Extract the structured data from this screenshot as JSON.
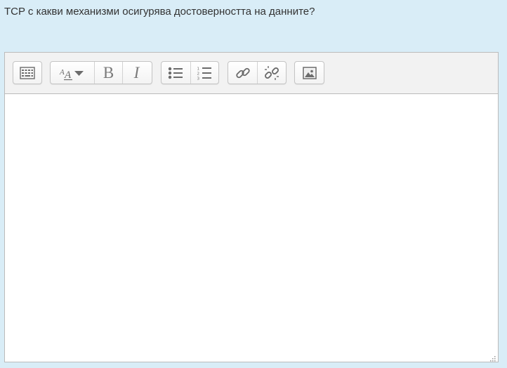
{
  "question": {
    "text": "TCP с какви механизми осигурява достоверността на данните?"
  },
  "editor": {
    "content": "",
    "toolbar": {
      "groups": [
        {
          "name": "toggle",
          "buttons": [
            "show-more-buttons-icon"
          ]
        },
        {
          "name": "style",
          "buttons": [
            "font-size-icon",
            "B",
            "I"
          ]
        },
        {
          "name": "list",
          "buttons": [
            "unordered-list-icon",
            "ordered-list-icon"
          ]
        },
        {
          "name": "links",
          "buttons": [
            "link-icon",
            "unlink-icon"
          ]
        },
        {
          "name": "files",
          "buttons": [
            "image-icon"
          ]
        }
      ],
      "bold_label": "B",
      "italic_label": "I"
    }
  },
  "colors": {
    "page_background": "#d9edf7",
    "toolbar_background": "#f2f2f2",
    "icon_color": "#6b6b6b",
    "border": "#bbbbbb"
  }
}
